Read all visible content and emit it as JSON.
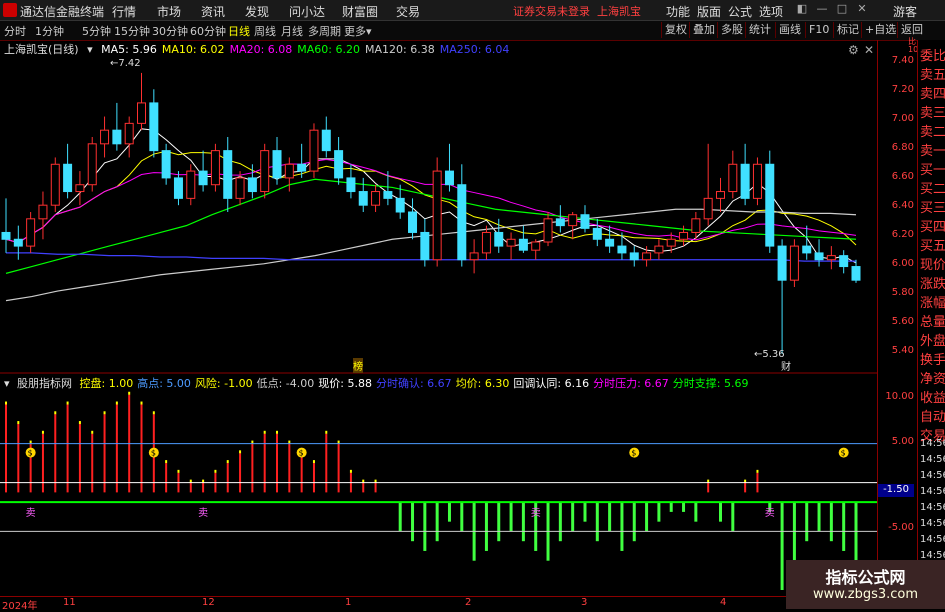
{
  "app": {
    "title": "通达信金融终端",
    "menu": [
      "行情",
      "市场",
      "资讯",
      "发现",
      "问小达",
      "财富圈",
      "交易"
    ],
    "notice": "证券交易未登录",
    "stock_name_top": "上海凯宝",
    "right_menu": [
      "功能",
      "版面",
      "公式",
      "选项"
    ],
    "guest": "游客"
  },
  "toolbar": {
    "periods": [
      "分时",
      "1分钟",
      "5分钟",
      "15分钟",
      "30分钟",
      "60分钟",
      "日线",
      "周线",
      "月线",
      "多周期",
      "更多"
    ],
    "active_period": "日线",
    "buttons": [
      "复权",
      "叠加",
      "多股",
      "统计",
      "画线",
      "F10",
      "标记",
      "+自选",
      "返回"
    ]
  },
  "main_chart": {
    "title": "上海凯宝(日线)",
    "ma": [
      {
        "label": "MA5: 5.96",
        "color": "#ffffff"
      },
      {
        "label": "MA10: 6.02",
        "color": "#ffff00"
      },
      {
        "label": "MA20: 6.08",
        "color": "#ff00ff"
      },
      {
        "label": "MA60: 6.20",
        "color": "#00ff00"
      },
      {
        "label": "MA120: 6.38",
        "color": "#cccccc"
      },
      {
        "label": "MA250: 6.04",
        "color": "#4040ff"
      }
    ],
    "high_label": "7.42",
    "low_label": "5.36",
    "marker_bang": "榜",
    "marker_cai": "财",
    "y_ticks": [
      "7.40",
      "7.20",
      "7.00",
      "6.80",
      "6.60",
      "6.40",
      "6.20",
      "6.00",
      "5.80",
      "5.60",
      "5.40"
    ]
  },
  "indicator": {
    "title": "股朋指标网",
    "items": [
      {
        "label": "控盘: 1.00",
        "color": "#ffff00"
      },
      {
        "label": "高点: 5.00",
        "color": "#4d9bff"
      },
      {
        "label": "风险: -1.00",
        "color": "#ffff00"
      },
      {
        "label": "低点: -4.00",
        "color": "#cccccc"
      },
      {
        "label": "现价: 5.88",
        "color": "#ffffff"
      },
      {
        "label": "分时确认: 6.67",
        "color": "#4040ff"
      },
      {
        "label": "均价: 6.30",
        "color": "#ffff00"
      },
      {
        "label": "回调认同: 6.16",
        "color": "#ffffff"
      },
      {
        "label": "分时压力: 6.67",
        "color": "#ff00ff"
      },
      {
        "label": "分时支撑: 5.69",
        "color": "#00ff00"
      }
    ],
    "y_ticks": [
      "10.00",
      "5.00",
      "-1.50",
      "-5.00"
    ],
    "marker_label": "-1.50",
    "markers": [
      {
        "type": "coin",
        "label": "$"
      },
      {
        "type": "sell",
        "label": "卖"
      }
    ]
  },
  "side_panel": [
    "委比",
    "卖五",
    "卖四",
    "卖三",
    "卖二",
    "卖一",
    "买一",
    "买二",
    "买三",
    "买四",
    "买五",
    "现价",
    "涨跌",
    "涨幅",
    "总量",
    "外盘",
    "换手",
    "净资",
    "收益",
    "自动",
    "交易"
  ],
  "side_times": [
    "14:56",
    "14:56",
    "14:56",
    "14:56",
    "14:56",
    "14:56",
    "14:56",
    "14:56",
    "14:56",
    "14:56",
    "14:56"
  ],
  "date_labels": [
    "2024年",
    "11",
    "12",
    "1",
    "2",
    "3",
    "4"
  ],
  "watermark": {
    "line1": "指标公式网",
    "line2": "www.zbgs3.com"
  },
  "chart_data": {
    "type": "candlestick",
    "title": "上海凯宝(日线)",
    "ylim": [
      5.3,
      7.5
    ],
    "candles": [
      [
        6.25,
        6.5,
        6.1,
        6.2
      ],
      [
        6.2,
        6.3,
        6.05,
        6.15
      ],
      [
        6.15,
        6.4,
        6.1,
        6.35
      ],
      [
        6.35,
        6.55,
        6.2,
        6.45
      ],
      [
        6.45,
        6.8,
        6.4,
        6.75
      ],
      [
        6.75,
        6.9,
        6.5,
        6.55
      ],
      [
        6.55,
        6.7,
        6.45,
        6.6
      ],
      [
        6.6,
        6.95,
        6.55,
        6.9
      ],
      [
        6.9,
        7.1,
        6.8,
        7.0
      ],
      [
        7.0,
        7.2,
        6.85,
        6.9
      ],
      [
        6.9,
        7.1,
        6.8,
        7.05
      ],
      [
        7.05,
        7.42,
        7.0,
        7.2
      ],
      [
        7.2,
        7.3,
        6.8,
        6.85
      ],
      [
        6.85,
        6.9,
        6.6,
        6.65
      ],
      [
        6.65,
        6.7,
        6.45,
        6.5
      ],
      [
        6.5,
        6.75,
        6.45,
        6.7
      ],
      [
        6.7,
        6.85,
        6.55,
        6.6
      ],
      [
        6.6,
        6.9,
        6.55,
        6.85
      ],
      [
        6.85,
        6.95,
        6.4,
        6.5
      ],
      [
        6.5,
        6.7,
        6.45,
        6.65
      ],
      [
        6.65,
        6.75,
        6.5,
        6.55
      ],
      [
        6.55,
        6.9,
        6.5,
        6.85
      ],
      [
        6.85,
        6.95,
        6.6,
        6.65
      ],
      [
        6.65,
        6.8,
        6.55,
        6.75
      ],
      [
        6.75,
        6.9,
        6.65,
        6.7
      ],
      [
        6.7,
        7.05,
        6.65,
        7.0
      ],
      [
        7.0,
        7.1,
        6.8,
        6.85
      ],
      [
        6.85,
        6.95,
        6.6,
        6.65
      ],
      [
        6.65,
        6.75,
        6.5,
        6.55
      ],
      [
        6.55,
        6.65,
        6.4,
        6.45
      ],
      [
        6.45,
        6.6,
        6.4,
        6.55
      ],
      [
        6.55,
        6.7,
        6.45,
        6.5
      ],
      [
        6.5,
        6.6,
        6.35,
        6.4
      ],
      [
        6.4,
        6.5,
        6.2,
        6.25
      ],
      [
        6.25,
        6.35,
        6.0,
        6.05
      ],
      [
        6.05,
        6.8,
        6.0,
        6.7
      ],
      [
        6.7,
        6.9,
        6.55,
        6.6
      ],
      [
        6.6,
        6.75,
        6.0,
        6.05
      ],
      [
        6.05,
        6.2,
        5.95,
        6.1
      ],
      [
        6.1,
        6.3,
        6.05,
        6.25
      ],
      [
        6.25,
        6.35,
        6.1,
        6.15
      ],
      [
        6.15,
        6.25,
        6.05,
        6.2
      ],
      [
        6.2,
        6.3,
        6.1,
        6.12
      ],
      [
        6.12,
        6.2,
        6.05,
        6.18
      ],
      [
        6.18,
        6.4,
        6.15,
        6.35
      ],
      [
        6.35,
        6.45,
        6.25,
        6.3
      ],
      [
        6.3,
        6.4,
        6.2,
        6.38
      ],
      [
        6.38,
        6.45,
        6.25,
        6.28
      ],
      [
        6.28,
        6.35,
        6.15,
        6.2
      ],
      [
        6.2,
        6.3,
        6.1,
        6.15
      ],
      [
        6.15,
        6.25,
        6.05,
        6.1
      ],
      [
        6.1,
        6.15,
        6.0,
        6.05
      ],
      [
        6.05,
        6.15,
        6.0,
        6.1
      ],
      [
        6.1,
        6.2,
        6.05,
        6.15
      ],
      [
        6.15,
        6.25,
        6.1,
        6.2
      ],
      [
        6.2,
        6.3,
        6.15,
        6.25
      ],
      [
        6.25,
        6.4,
        6.2,
        6.35
      ],
      [
        6.35,
        6.9,
        6.3,
        6.5
      ],
      [
        6.5,
        6.65,
        6.4,
        6.55
      ],
      [
        6.55,
        6.85,
        6.5,
        6.75
      ],
      [
        6.75,
        6.9,
        6.45,
        6.5
      ],
      [
        6.5,
        6.8,
        6.45,
        6.75
      ],
      [
        6.75,
        6.85,
        6.1,
        6.15
      ],
      [
        6.15,
        6.2,
        5.36,
        5.9
      ],
      [
        5.9,
        6.2,
        5.85,
        6.15
      ],
      [
        6.15,
        6.3,
        6.05,
        6.1
      ],
      [
        6.1,
        6.2,
        6.0,
        6.05
      ],
      [
        6.05,
        6.15,
        5.98,
        6.08
      ],
      [
        6.08,
        6.12,
        5.95,
        6.0
      ],
      [
        6.0,
        6.05,
        5.88,
        5.9
      ]
    ],
    "ma_series": [
      {
        "name": "MA60",
        "values": [
          5.95,
          6.0,
          6.05,
          6.1,
          6.15,
          6.2,
          6.25,
          6.3,
          6.38,
          6.45,
          6.52,
          6.6,
          6.64,
          6.62,
          6.6,
          6.58,
          6.54,
          6.5,
          6.46,
          6.42,
          6.4,
          6.38,
          6.36,
          6.34,
          6.32,
          6.3,
          6.28,
          6.26,
          6.25,
          6.24,
          6.23,
          6.22,
          6.21,
          6.2
        ]
      },
      {
        "name": "MA120",
        "values": [
          5.75,
          5.78,
          5.82,
          5.85,
          5.88,
          5.91,
          5.94,
          5.96,
          5.98,
          6.0,
          6.02,
          6.05,
          6.08,
          6.12,
          6.16,
          6.2,
          6.22,
          6.24,
          6.26,
          6.28,
          6.3,
          6.32,
          6.34,
          6.36,
          6.38,
          6.4,
          6.42,
          6.42,
          6.41,
          6.4,
          6.4,
          6.39,
          6.39,
          6.38
        ]
      },
      {
        "name": "MA250",
        "values": [
          6.1,
          6.1,
          6.09,
          6.09,
          6.08,
          6.08,
          6.07,
          6.07,
          6.06,
          6.06,
          6.06,
          6.05,
          6.05,
          6.05,
          6.05,
          6.05,
          6.05,
          6.05,
          6.05,
          6.05,
          6.05,
          6.05,
          6.05,
          6.05,
          6.05,
          6.05,
          6.05,
          6.05,
          6.05,
          6.05,
          6.05,
          6.04,
          6.04,
          6.04
        ]
      }
    ],
    "indicator_bars": [
      9,
      7,
      5,
      6,
      8,
      9,
      7,
      6,
      8,
      9,
      10,
      9,
      8,
      3,
      2,
      1,
      1,
      2,
      3,
      4,
      5,
      6,
      6,
      5,
      4,
      3,
      6,
      5,
      2,
      1,
      1,
      0,
      -3,
      -4,
      -5,
      -4,
      -2,
      -3,
      -6,
      -5,
      -4,
      -3,
      -4,
      -5,
      -6,
      -4,
      -3,
      -2,
      -4,
      -3,
      -5,
      -4,
      -3,
      -2,
      -1,
      -1,
      -2,
      1,
      -2,
      -3,
      1,
      2,
      -1,
      -9,
      -6,
      -4,
      -3,
      -4,
      -5,
      -7
    ]
  }
}
